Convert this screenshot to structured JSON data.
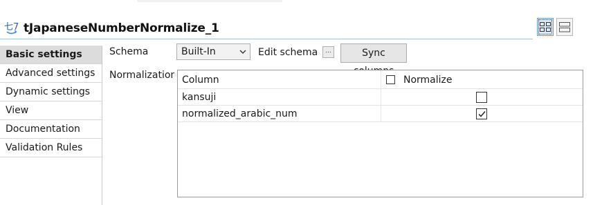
{
  "component": {
    "title": "tJapaneseNumberNormalize_1",
    "icon": "japanese-number-icon",
    "icon_glyph": "七7"
  },
  "view_toggle": {
    "icon_a": "grid-view-icon",
    "icon_b": "list-view-icon"
  },
  "sidebar": {
    "items": [
      {
        "label": "Basic settings",
        "selected": true
      },
      {
        "label": "Advanced settings",
        "selected": false
      },
      {
        "label": "Dynamic settings",
        "selected": false
      },
      {
        "label": "View",
        "selected": false
      },
      {
        "label": "Documentation",
        "selected": false
      },
      {
        "label": "Validation Rules",
        "selected": false
      }
    ]
  },
  "schema": {
    "label": "Schema",
    "value": "Built-In",
    "edit_label": "Edit schema",
    "dots_label": "...",
    "sync_label": "Sync columns"
  },
  "normalization": {
    "label": "Normalization",
    "columns": [
      "Column",
      "Normalize"
    ],
    "header_checked": false,
    "rows": [
      {
        "column": "kansuji",
        "normalize": false
      },
      {
        "column": "normalized_arabic_num",
        "normalize": true
      }
    ]
  },
  "colors": {
    "accent": "#6a9bd1",
    "selected_sidebar": "#dcdcdc",
    "title_border": "#9ec1e6"
  }
}
